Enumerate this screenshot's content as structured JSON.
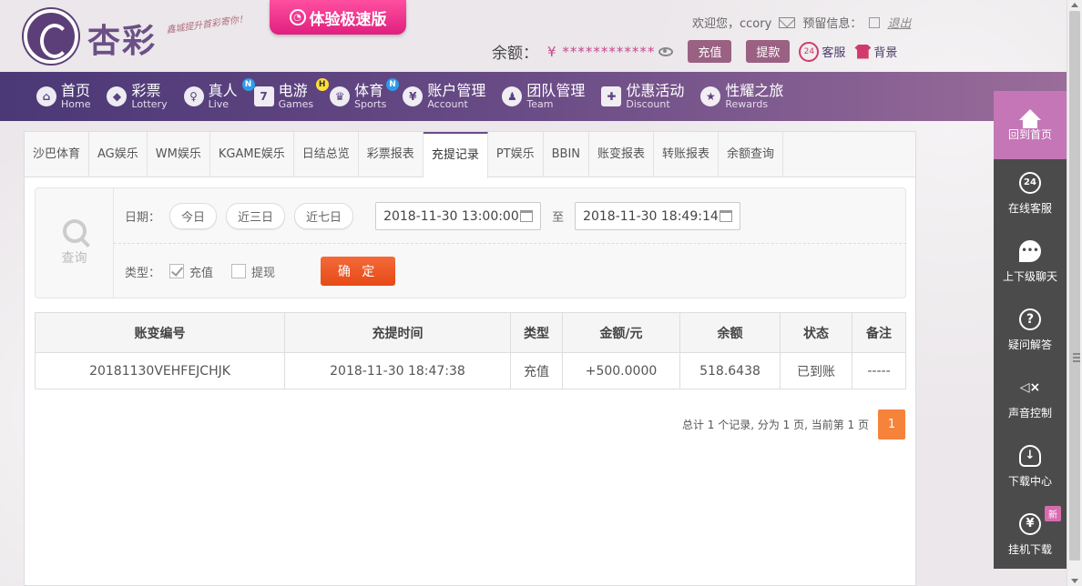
{
  "header": {
    "logo_text": "杏彩",
    "logo_slogan": "鑫城提升首彩寄你！",
    "speed_button": "体验极速版",
    "welcome": "欢迎您，",
    "username": "ccory",
    "message_label": "预留信息：",
    "logout": "退出",
    "balance_label": "余额：",
    "currency": "¥",
    "balance_masked": "************",
    "recharge_button": "充值",
    "withdraw_button": "提款",
    "support_badge": "24",
    "support_link": "客服",
    "background_link": "背景"
  },
  "nav": [
    {
      "cn": "首页",
      "en": "Home",
      "icon": "home-icon",
      "glyph": "⌂"
    },
    {
      "cn": "彩票",
      "en": "Lottery",
      "icon": "lottery-icon",
      "glyph": "◆"
    },
    {
      "cn": "真人",
      "en": "Live",
      "icon": "live-icon",
      "glyph": "♀",
      "badge": "N"
    },
    {
      "cn": "电游",
      "en": "Games",
      "icon": "games-icon",
      "glyph": "7",
      "badge": "H"
    },
    {
      "cn": "体育",
      "en": "Sports",
      "icon": "trophy-icon",
      "glyph": "♛",
      "badge": "N"
    },
    {
      "cn": "账户管理",
      "en": "Account",
      "icon": "account-icon",
      "glyph": "¥"
    },
    {
      "cn": "团队管理",
      "en": "Team",
      "icon": "team-icon",
      "glyph": "♟"
    },
    {
      "cn": "优惠活动",
      "en": "Discount",
      "icon": "gift-icon",
      "glyph": "✚"
    },
    {
      "cn": "性耀之旅",
      "en": "Rewards",
      "icon": "rewards-icon",
      "glyph": "★"
    }
  ],
  "tabs": [
    "沙巴体育",
    "AG娱乐",
    "WM娱乐",
    "KGAME娱乐",
    "日结总览",
    "彩票报表",
    "充提记录",
    "PT娱乐",
    "BBIN",
    "账变报表",
    "转账报表",
    "余额查询"
  ],
  "active_tab": "充提记录",
  "query": {
    "side_label": "查询",
    "date_label": "日期：",
    "quick_today": "今日",
    "quick_3days": "近三日",
    "quick_7days": "近七日",
    "start_date": "2018-11-30 13:00:00",
    "to_label": "至",
    "end_date": "2018-11-30 18:49:14",
    "type_label": "类型：",
    "type_recharge": "充值",
    "type_withdraw": "提现",
    "confirm": "确 定"
  },
  "table": {
    "headers": [
      "账变编号",
      "充提时间",
      "类型",
      "金额/元",
      "余额",
      "状态",
      "备注"
    ],
    "rows": [
      [
        "20181130VEHFEJCHJK",
        "2018-11-30 18:47:38",
        "充值",
        "+500.0000",
        "518.6438",
        "已到账",
        "-----"
      ]
    ]
  },
  "pagination": {
    "summary": "总计 1 个记录, 分为 1 页, 当前第 1 页",
    "current_page": "1"
  },
  "sidebar": [
    {
      "label": "回到首页",
      "icon": "home-icon"
    },
    {
      "label": "在线客服",
      "icon": "support-icon",
      "glyph": "24"
    },
    {
      "label": "上下级聊天",
      "icon": "chat-icon",
      "glyph": "•••"
    },
    {
      "label": "疑问解答",
      "icon": "question-icon",
      "glyph": "?"
    },
    {
      "label": "声音控制",
      "icon": "sound-icon",
      "glyph": "◁×"
    },
    {
      "label": "下载中心",
      "icon": "download-icon",
      "glyph": "↓"
    },
    {
      "label": "挂机下载",
      "icon": "money-bag-icon",
      "glyph": "¥",
      "badge": "新"
    }
  ]
}
